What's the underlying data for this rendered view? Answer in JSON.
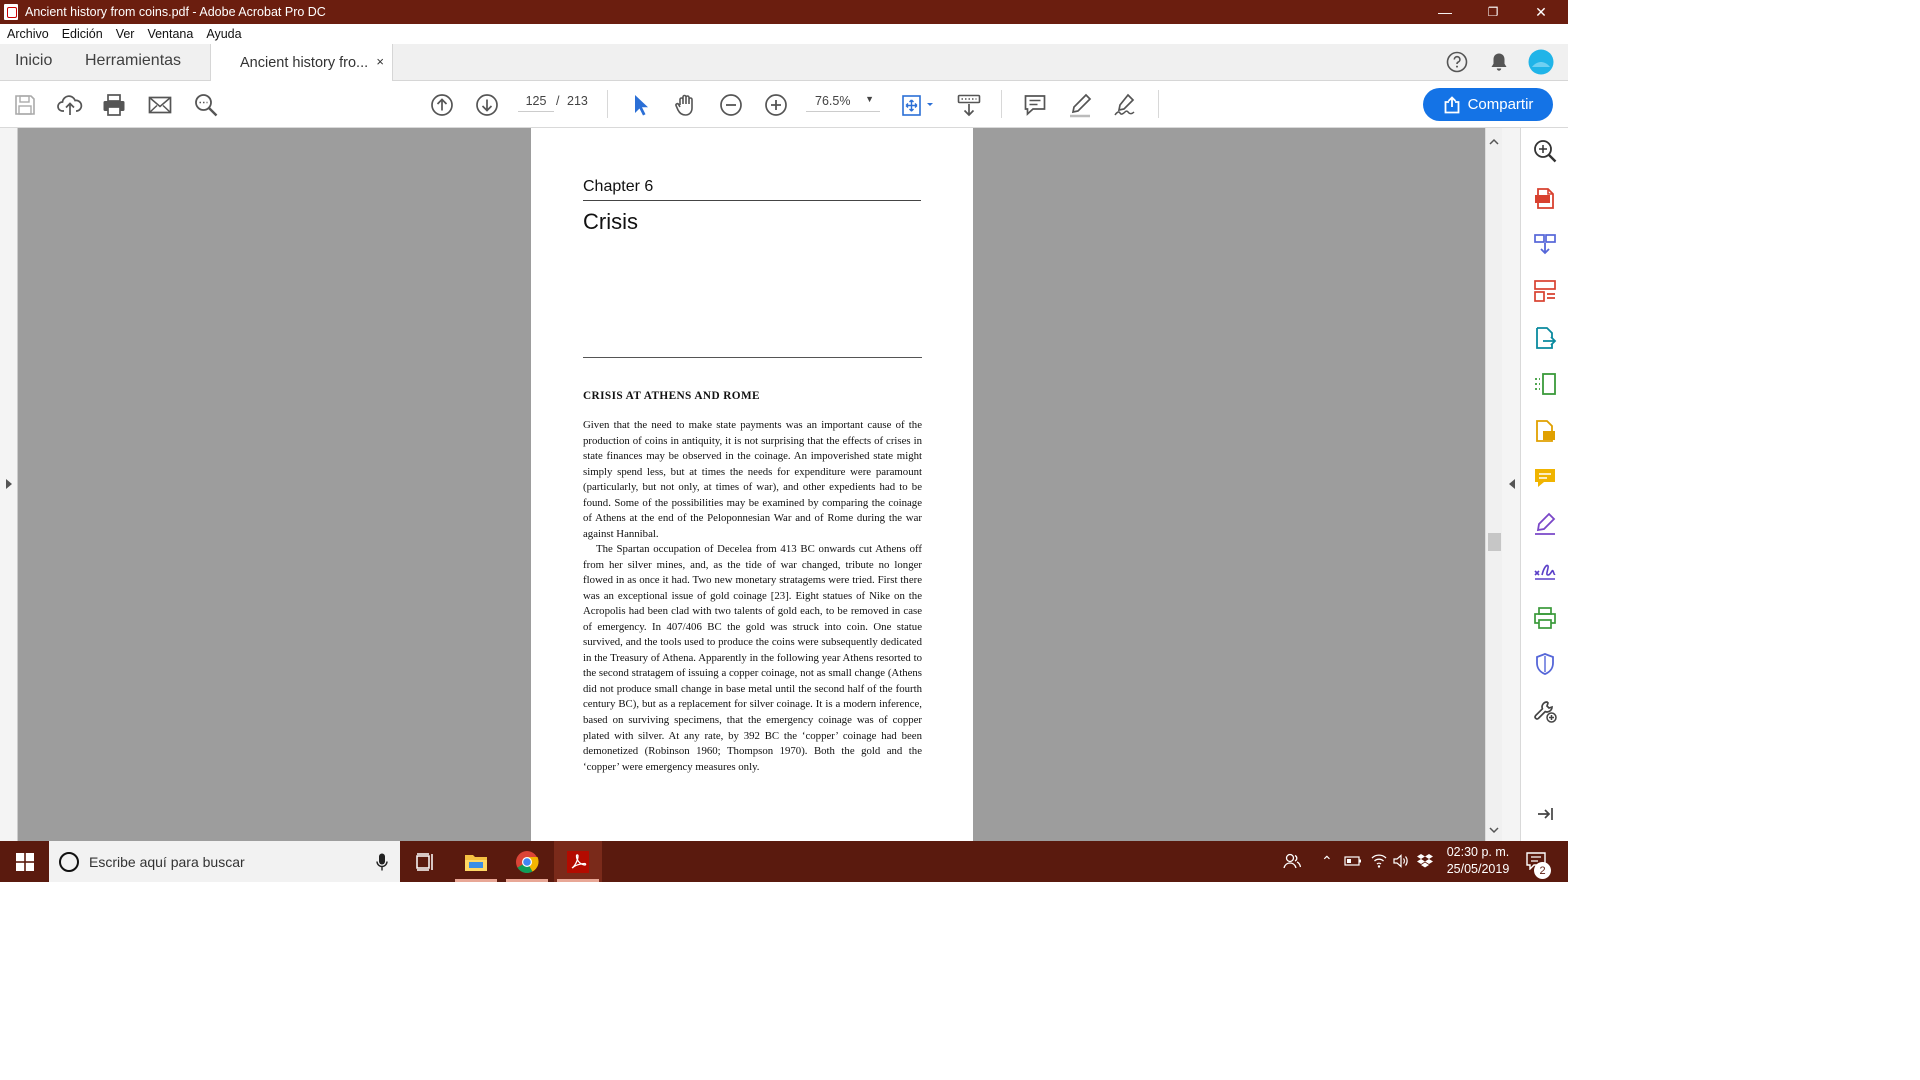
{
  "window": {
    "title": "Ancient history from coins.pdf - Adobe Acrobat Pro DC",
    "minimize": "—",
    "restore": "❐",
    "close": "✕"
  },
  "menu": [
    "Archivo",
    "Edición",
    "Ver",
    "Ventana",
    "Ayuda"
  ],
  "tabs": {
    "home": "Inicio",
    "tools": "Herramientas",
    "document": "Ancient history fro...",
    "close": "×"
  },
  "toolbar": {
    "current_page": "125",
    "page_separator": "/",
    "total_pages": "213",
    "zoom": "76.5%",
    "share_label": "Compartir"
  },
  "colors": {
    "titlebar": "#6b1e0f",
    "taskbar": "#5a1a0e",
    "accent": "#1473e6",
    "canvas": "#9d9d9d"
  },
  "document": {
    "chapter": "Chapter 6",
    "title": "Crisis",
    "section_heading": "CRISIS AT ATHENS AND ROME",
    "paragraph_1": "Given that the need to make state payments was an important cause of the production of coins in antiquity, it is not surprising that the effects of crises in state finances may be observed in the coinage. An impoverished state might simply spend less, but at times the needs for expenditure were paramount (particularly, but not only, at times of war), and other expedients had to be found. Some of the possibilities may be examined by comparing the coinage of Athens at the end of the Peloponnesian War and of Rome during the war against Hannibal.",
    "paragraph_2": "The Spartan occupation of Decelea from 413 BC onwards cut Athens off from her silver mines, and, as the tide of war changed, tribute no longer flowed in as once it had. Two new monetary stratagems were tried. First there was an exceptional issue of gold coinage [23]. Eight statues of Nike on the Acropolis had been clad with two talents of gold each, to be removed in case of emergency. In 407/406 BC the gold was struck into coin. One statue survived, and the tools used to produce the coins were subsequently dedicated in the Treasury of Athena. Apparently in the following year Athens resorted to the second stratagem of issuing a copper coinage, not as small change (Athens did not produce small change in base metal until the second half of the fourth century BC), but as a replacement for silver coinage. It is a modern inference, based on surviving specimens, that the emergency coinage was of copper plated with silver. At any rate, by 392 BC the ‘copper’ coinage had been demonetized (Robinson 1960; Thompson 1970). Both the gold and the ‘copper’ were emergency measures only."
  },
  "taskbar": {
    "search_placeholder": "Escribe aquí para buscar",
    "time": "02:30 p. m.",
    "date": "25/05/2019",
    "notification_count": "2"
  }
}
